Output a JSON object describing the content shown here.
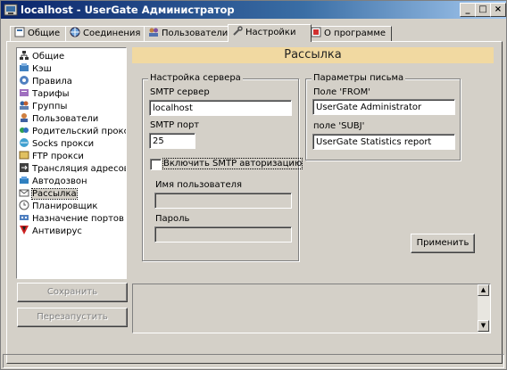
{
  "window": {
    "title": "localhost - UserGate Администратор",
    "minimize_glyph": "_",
    "maximize_glyph": "□",
    "close_glyph": "×"
  },
  "tabs": [
    {
      "label": "Общие",
      "icon": "general-icon"
    },
    {
      "label": "Соединения",
      "icon": "connections-icon"
    },
    {
      "label": "Пользователи",
      "icon": "users-icon"
    },
    {
      "label": "Настройки",
      "icon": "settings-icon",
      "active": true
    },
    {
      "label": "О программе",
      "icon": "about-icon"
    }
  ],
  "sidebar": {
    "items": [
      {
        "label": "Общие",
        "icon": "network-icon"
      },
      {
        "label": "Кэш",
        "icon": "cache-icon"
      },
      {
        "label": "Правила",
        "icon": "rules-icon"
      },
      {
        "label": "Тарифы",
        "icon": "tariffs-icon"
      },
      {
        "label": "Группы",
        "icon": "groups-icon"
      },
      {
        "label": "Пользователи",
        "icon": "users-icon"
      },
      {
        "label": "Родительский прокси",
        "icon": "parent-proxy-icon"
      },
      {
        "label": "Socks прокси",
        "icon": "socks-icon"
      },
      {
        "label": "FTP прокси",
        "icon": "ftp-icon"
      },
      {
        "label": "Трансляция адресов",
        "icon": "nat-icon"
      },
      {
        "label": "Автодозвон",
        "icon": "autodial-icon"
      },
      {
        "label": "Рассылка",
        "icon": "mailing-icon",
        "selected": true
      },
      {
        "label": "Планировщик",
        "icon": "scheduler-icon"
      },
      {
        "label": "Назначение портов",
        "icon": "ports-icon"
      },
      {
        "label": "Антивирус",
        "icon": "antivirus-icon"
      }
    ]
  },
  "main": {
    "header": "Рассылка",
    "server_group": {
      "title": "Настройка сервера",
      "smtp_server_label": "SMTP сервер",
      "smtp_server_value": "localhost",
      "smtp_port_label": "SMTP порт",
      "smtp_port_value": "25",
      "auth_checkbox_label": "Включить SMTP авторизацию",
      "username_label": "Имя пользователя",
      "username_value": "",
      "password_label": "Пароль",
      "password_value": ""
    },
    "letter_group": {
      "title": "Параметры письма",
      "from_label": "Поле 'FROM'",
      "from_value": "UserGate Administrator",
      "subject_label": "поле 'SUBJ'",
      "subject_value": "UserGate Statistics report"
    },
    "apply_button": "Применить"
  },
  "bottom": {
    "save_button": "Сохранить",
    "restart_button": "Перезапустить",
    "scroll_up_glyph": "▲",
    "scroll_down_glyph": "▼"
  }
}
